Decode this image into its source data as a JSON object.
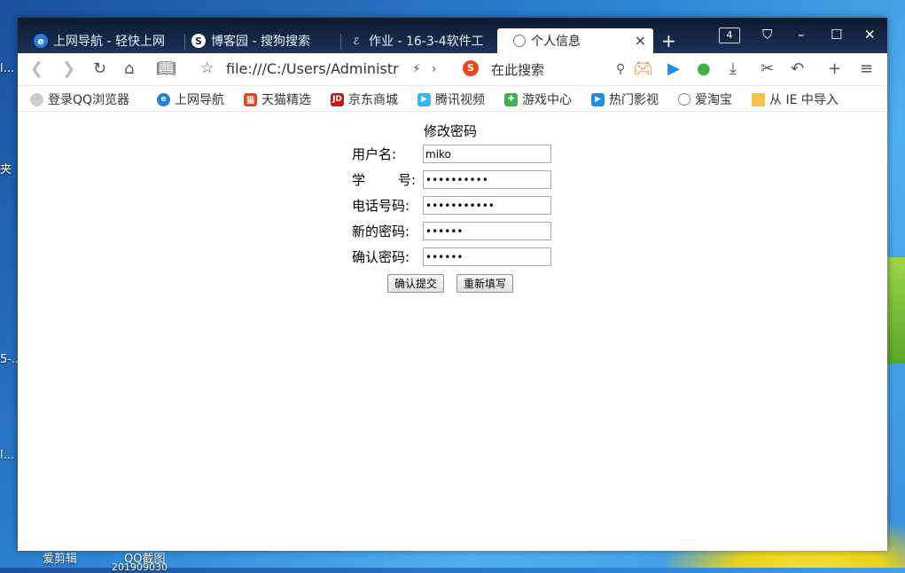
{
  "desktop": {
    "label_1": "l...",
    "label_2": "夹",
    "label_3": "5-...",
    "label_4": "l...",
    "label_5": "爱剪辑",
    "label_6": "QQ截图",
    "label_7": "201909030"
  },
  "tabs": [
    {
      "label": "上网导航 - 轻快上网",
      "icon": "ie-icon",
      "active": false
    },
    {
      "label": "博客园 - 搜狗搜索",
      "icon": "sogou-icon",
      "active": false
    },
    {
      "label": "作业 - 16-3-4软件工",
      "icon": "homework-icon",
      "active": false
    },
    {
      "label": "个人信息",
      "icon": "globe-icon",
      "active": true
    }
  ],
  "window": {
    "tab_count": "4",
    "new_tab": "+",
    "close_tab": "×"
  },
  "toolbar": {
    "address": "file:///C:/Users/Administr",
    "search_placeholder": "在此搜索"
  },
  "bookmarks": [
    {
      "label": "登录QQ浏览器",
      "color": "#cccccc"
    },
    {
      "label": "上网导航",
      "color": "#2b7bd8"
    },
    {
      "label": "天猫精选",
      "color": "#e8461f"
    },
    {
      "label": "京东商城",
      "color": "#c8161d"
    },
    {
      "label": "腾讯视频",
      "color": "#32b6ef"
    },
    {
      "label": "游戏中心",
      "color": "#3cb44a"
    },
    {
      "label": "热门影视",
      "color": "#1e8fe8"
    },
    {
      "label": "爱淘宝",
      "color": "#888888"
    },
    {
      "label": "从 IE 中导入",
      "color": "#f2c14e"
    }
  ],
  "form": {
    "title": "修改密码",
    "username_label": "用户名:",
    "username_value": "miko",
    "student_id_label_1": "学",
    "student_id_label_2": "号:",
    "student_id_value": "••••••••••",
    "phone_label": "电话号码:",
    "phone_value": "•••••••••••",
    "new_password_label": "新的密码:",
    "new_password_value": "••••••",
    "confirm_password_label": "确认密码:",
    "confirm_password_value": "••••••",
    "submit_label": "确认提交",
    "reset_label": "重新填写"
  }
}
